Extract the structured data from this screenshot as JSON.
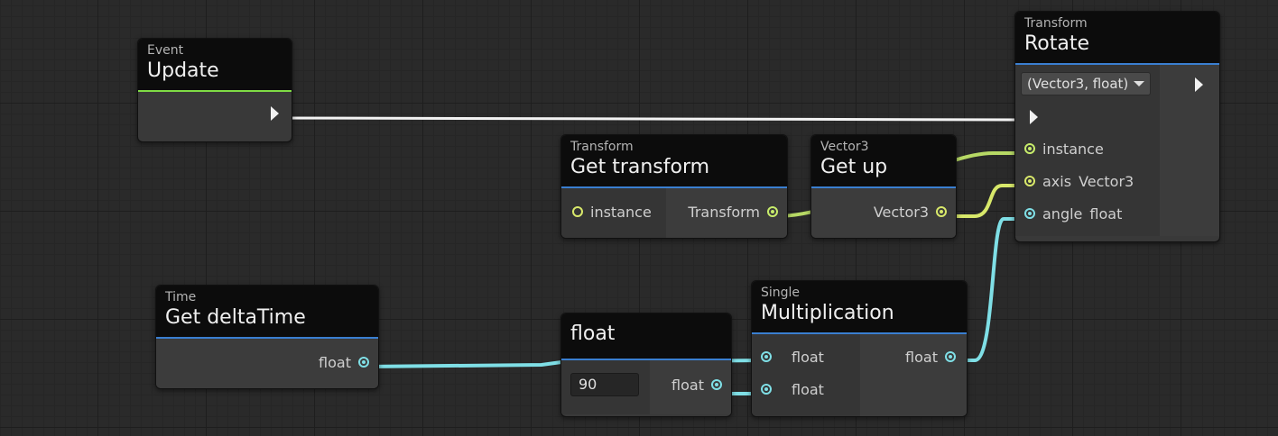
{
  "nodes": {
    "update": {
      "kind": "Event",
      "title": "Update"
    },
    "rotate": {
      "kind": "Transform",
      "title": "Rotate",
      "overload": "(Vector3, float)",
      "inputs": [
        {
          "name": "instance",
          "type": ""
        },
        {
          "name": "axis",
          "type": "Vector3"
        },
        {
          "name": "angle",
          "type": "float"
        }
      ]
    },
    "get_transform": {
      "kind": "Transform",
      "title": "Get transform",
      "input": "instance",
      "output": "Transform"
    },
    "get_up": {
      "kind": "Vector3",
      "title": "Get up",
      "output": "Vector3"
    },
    "get_delta_time": {
      "kind": "Time",
      "title": "Get deltaTime",
      "output": "float"
    },
    "float_literal": {
      "title": "float",
      "value": "90",
      "output": "float"
    },
    "multiplication": {
      "kind": "Single",
      "title": "Multiplication",
      "inputs": [
        "float",
        "float"
      ],
      "output": "float"
    }
  },
  "colors": {
    "flow": "#f2f2f2",
    "transform_wire": "#c7ec6b",
    "vector_wire": "#d8e86a",
    "float_wire": "#7fdfe6",
    "header_underline_blue": "#3a7fd1",
    "header_underline_green": "#7fdc45"
  },
  "icons": [
    "flow-port-icon",
    "dropdown-caret-icon",
    "port-dot-icon"
  ]
}
